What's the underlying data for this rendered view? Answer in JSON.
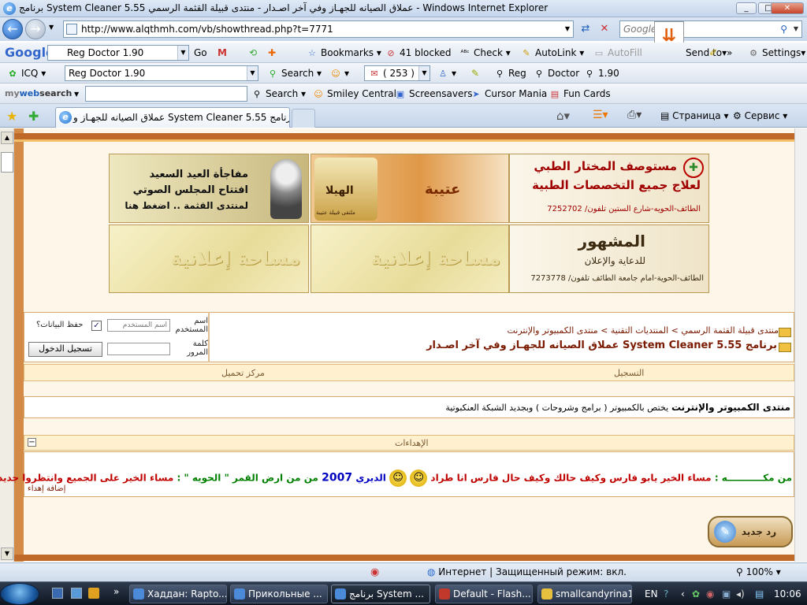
{
  "window": {
    "title": "برنامج System Cleaner 5.55 عملاق الصيانه للجهـاز وفي آخر اصـدار - منتدى قبيلة القثمة الرسمي - Windows Internet Explorer",
    "min": "_",
    "max": "□",
    "close": "✕"
  },
  "address": {
    "url": "http://www.alqthmh.com/vb/showthread.php?t=7771",
    "search_placeholder": "Google"
  },
  "google_toolbar": {
    "logo": "Google",
    "query": "Reg Doctor 1.90",
    "go": "Go",
    "bookmarks": "Bookmarks",
    "blocked": "41 blocked",
    "check": "Check",
    "autolink": "AutoLink",
    "autofill": "AutoFill",
    "sendto": "Send to",
    "more": "»",
    "settings": "Settings"
  },
  "icq_toolbar": {
    "icq": "ICQ",
    "query": "Reg Doctor 1.90",
    "search": "Search",
    "count": "( 253 )",
    "reg": "Reg",
    "doctor": "Doctor",
    "version": "1.90"
  },
  "mywebsearch": {
    "logo_my": "my",
    "logo_web": "web",
    "logo_search": "search",
    "search": "Search",
    "smiley": "Smiley Central",
    "screensavers": "Screensavers",
    "cursor": "Cursor Mania",
    "funcards": "Fun Cards"
  },
  "tabs": {
    "active": "عملاق الصيانه للجهـاز و System Cleaner 5.55 برنامج...",
    "page_menu": "Страница",
    "tools_menu": "Сервис"
  },
  "ads": {
    "ad1_line1": "مستوصف المختار الطبي",
    "ad1_line2": "لعلاج جميع التخصصات الطبية",
    "ad1_line3": "الطائف-الحويه-شارع الستين تلفون/ 7252702",
    "ad2_text": "عتيبة",
    "ad2_logo": "الهيلا",
    "ad2_sub": "ملتقى قبيلة عتيبة",
    "ad3_line1": "مفاجأة العيد السعيد",
    "ad3_line2": "افتتاح المجلس الصوتي",
    "ad3_line3": "لمنتدى القثمة .. اضغط هنا",
    "ad4_line1": "المشهور",
    "ad4_line2": "للدعاية والإعلان",
    "ad4_line3": "الطائف-الحوية-امام جامعة الطائف تلفون/ 7273778",
    "ad5_text": "مساحة إعلانية",
    "ad6_text": "مساحة إعلانية"
  },
  "breadcrumb": {
    "root": "منتدى قبيلة القثمة الرسمي",
    "sep": ">",
    "section": "المنتديات التقنية",
    "forum": "منتدى الكمبيوتر والإنترنت",
    "thread": "برنامج System Cleaner 5.55 عملاق الصيانه للجهـاز وفي آخر اصـدار"
  },
  "login": {
    "username_label": "اسم المستخدم",
    "username_placeholder": "اسم المستخدم",
    "remember": "حفظ البيانات؟",
    "password_label": "كلمة المرور",
    "submit": "تسجيل الدخول"
  },
  "navbar": {
    "register": "التسجيل",
    "upload": "مركز تحميل"
  },
  "forum_desc": {
    "title": "منتدى الكمبيوتر والإنترنت",
    "desc": "يختص بالكمبيوتر ( برامج وشروحات ) وبجديد الشبكة العنكبوتية"
  },
  "dedications": {
    "header": "الإهداءات",
    "collapse": "−",
    "text_a": "من مكـــــــــــه :",
    "text_b": "مساء الخير يابو فارس وكيف حالك وكيف حال فارس انا طراد",
    "text_c": "الديري",
    "text_d": "2007",
    "text_e": "من من ارض القمر",
    "text_f": "\" الحويه \" :",
    "text_g": "مساء الخير على الجميع وانتظروا جديد:",
    "add": "إضافة إهداء"
  },
  "reply_button": "رد جديد",
  "statusbar": {
    "zone": "Интернет | Защищенный режим: вкл.",
    "zoom": "100%"
  },
  "taskbar": {
    "tasks": [
      "Хаддан: Rapto...",
      "Прикольные ...",
      "برنامج System ...",
      "Default - Flash...",
      "smallcandyrina1"
    ],
    "lang": "EN",
    "clock": "10:06"
  },
  "colors": {
    "accent_brown": "#c06a2a",
    "link_maroon": "#7a1a00",
    "dedication_red": "#c00000",
    "dedication_blue": "#0000c0",
    "dedication_green": "#008000"
  }
}
